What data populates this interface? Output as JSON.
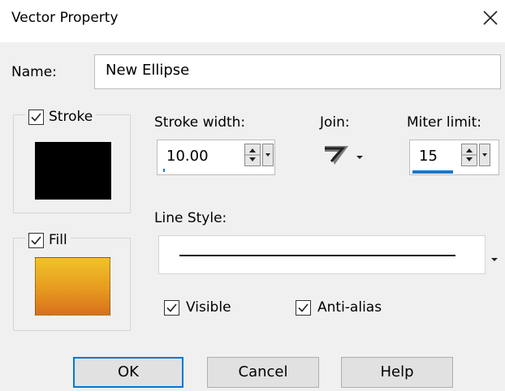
{
  "window": {
    "title": "Vector Property",
    "close_icon": "close-icon"
  },
  "name": {
    "label": "Name:",
    "value": "New Ellipse"
  },
  "stroke": {
    "label": "Stroke",
    "checked": true,
    "color": "#000000"
  },
  "fill": {
    "label": "Fill",
    "checked": true,
    "gradient": [
      "#efc328",
      "#e79a20",
      "#d8701c"
    ]
  },
  "stroke_width": {
    "label": "Stroke width:",
    "value": "10.00"
  },
  "join": {
    "label": "Join:",
    "icon": "miter-join-icon"
  },
  "miter_limit": {
    "label": "Miter limit:",
    "value": "15"
  },
  "line_style": {
    "label": "Line Style:"
  },
  "options": {
    "visible": {
      "label": "Visible",
      "checked": true
    },
    "anti_alias": {
      "label": "Anti-alias",
      "checked": true
    }
  },
  "buttons": {
    "ok": "OK",
    "cancel": "Cancel",
    "help": "Help"
  },
  "colors": {
    "focus_accent": "#0078d7"
  }
}
